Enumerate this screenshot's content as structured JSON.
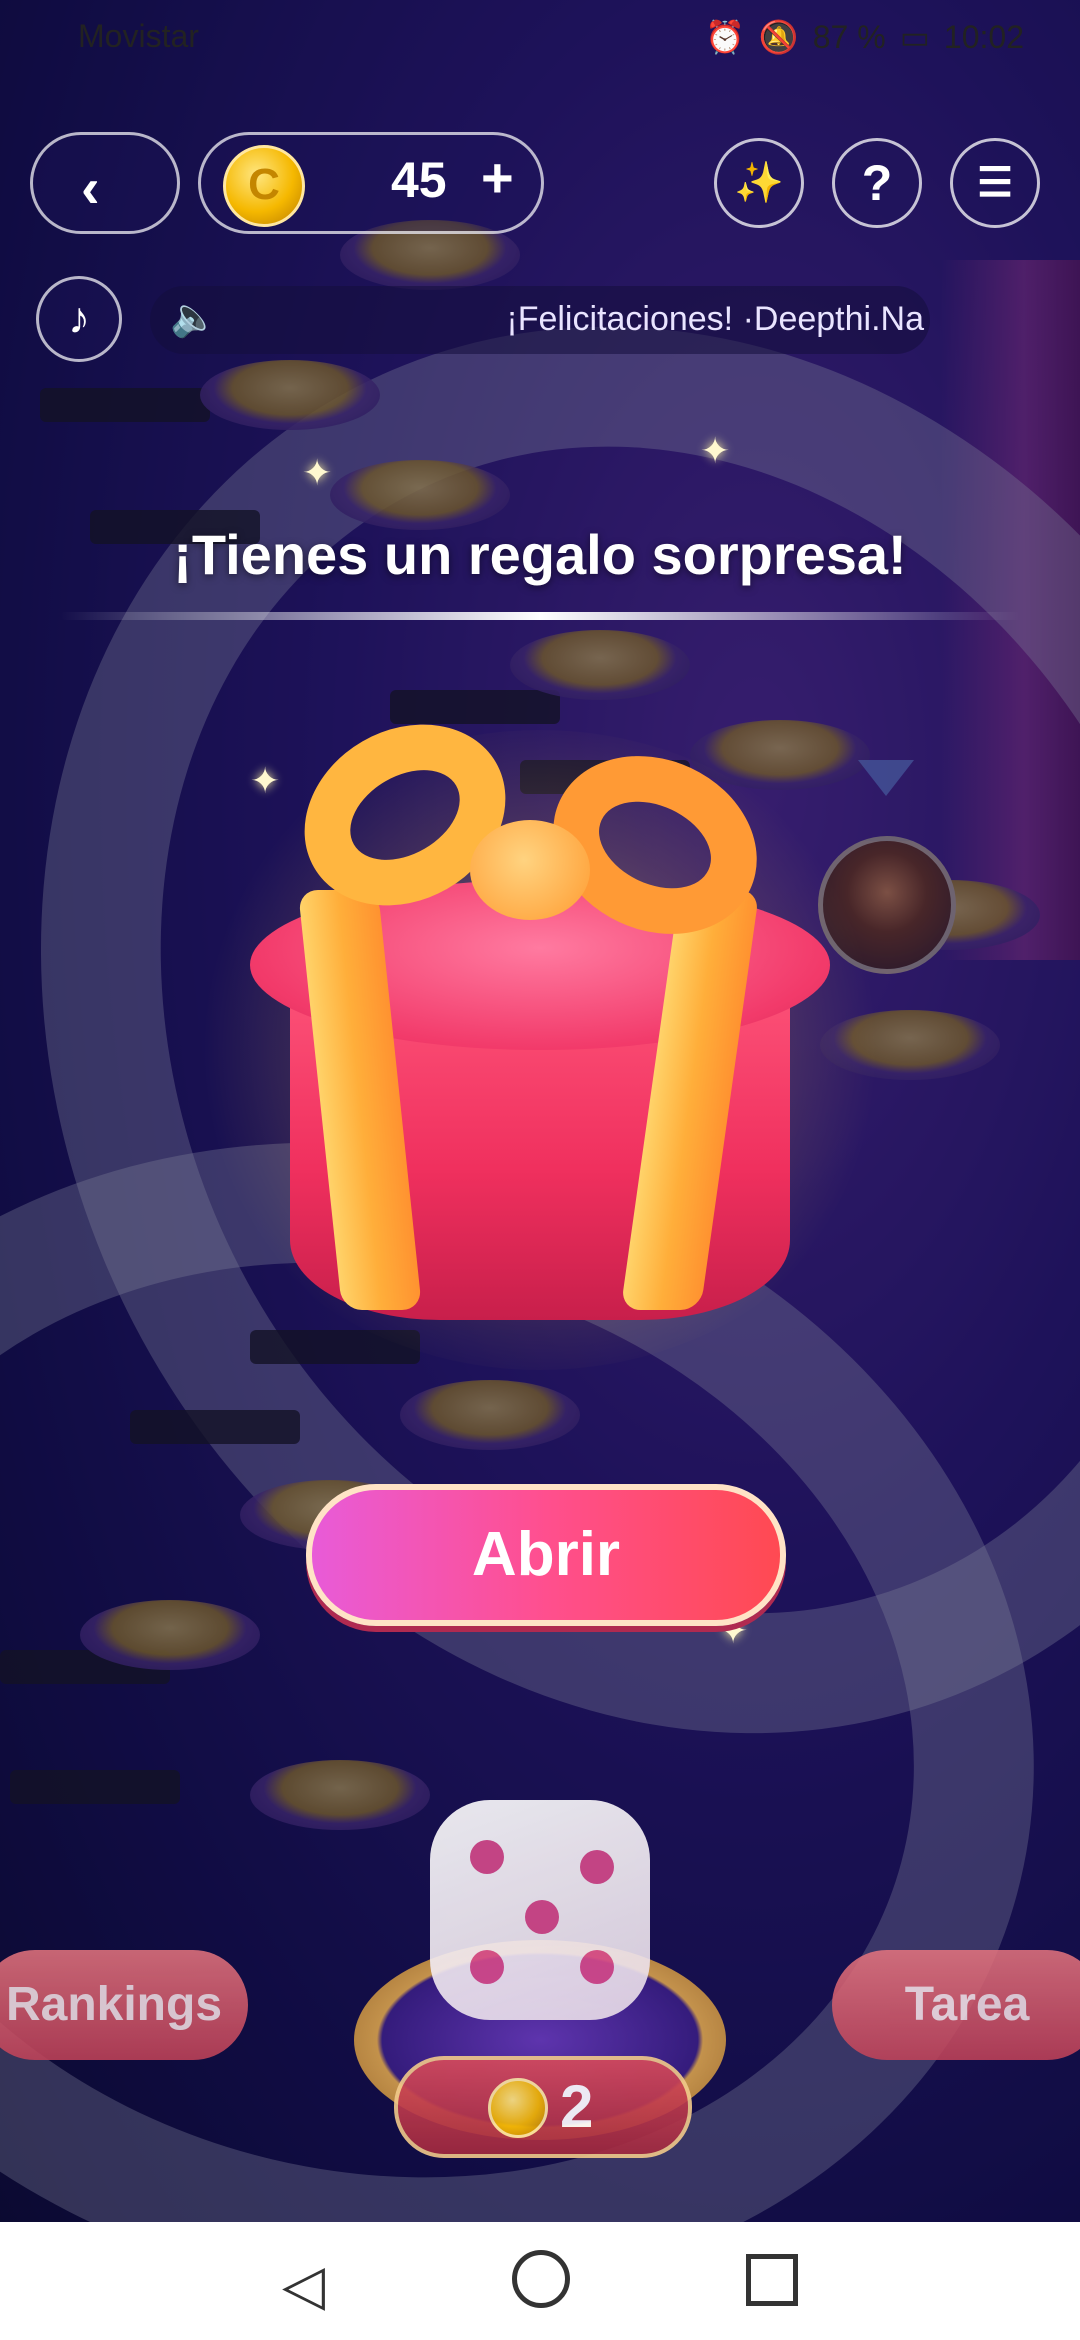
{
  "status_bar": {
    "carrier": "Movistar",
    "battery": "87 %",
    "time": "10:02"
  },
  "header": {
    "coins": "45",
    "plus": "+",
    "back_icon": "chevron-left-icon",
    "icons": [
      "magic-wand-icon",
      "help-icon",
      "history-icon"
    ]
  },
  "ticker": {
    "message": "¡Felicitaciones! ·Deepthi.Na"
  },
  "popup": {
    "title": "¡Tienes un regalo sorpresa!",
    "open_label": "Abrir"
  },
  "bottom": {
    "rankings_label": "Rankings",
    "task_label": "Tarea",
    "dice_cost": "2"
  }
}
